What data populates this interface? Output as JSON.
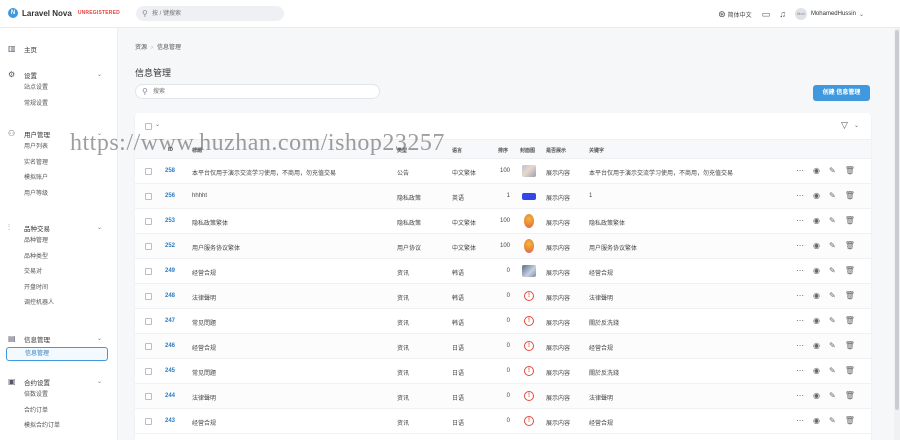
{
  "header": {
    "brand": "Laravel Nova",
    "tag": "UNREGISTERED",
    "search_placeholder": "按 / 键搜索",
    "language": "简体中文",
    "user_name": "MohamedHussin",
    "avatar_alt": "Moh"
  },
  "sidebar": [
    {
      "label": "主页",
      "icon": "dashboard-icon",
      "items": []
    },
    {
      "label": "设置",
      "icon": "gear-icon",
      "items": [
        "站点设置",
        "常规设置"
      ]
    },
    {
      "label": "用户管理",
      "icon": "users-icon",
      "items": [
        "用户列表",
        "实名管理",
        "模拟账户",
        "用户等级"
      ]
    },
    {
      "label": "品种交易",
      "icon": "sliders-icon",
      "items": [
        "品种管理",
        "品种类型",
        "交易对",
        "开盘时间",
        "调控机器人"
      ]
    },
    {
      "label": "信息管理",
      "icon": "message-icon",
      "items": [
        "信息管理"
      ]
    },
    {
      "label": "合约设置",
      "icon": "contract-icon",
      "items": [
        "倍数设置",
        "合约订单",
        "模拟合约订单"
      ]
    }
  ],
  "breadcrumb": {
    "root": "资源",
    "current": "信息管理"
  },
  "page_title": "信息管理",
  "search_placeholder": "搜索",
  "create_label": "创建 信息管理",
  "table": {
    "headers": {
      "id": "ID",
      "title": "标题",
      "type": "类型",
      "lang": "语言",
      "sort": "排序",
      "cover": "封面图",
      "show": "是否展示",
      "keyword": "关键字"
    },
    "rows": [
      {
        "id": "258",
        "title": "本平台仅用于演示交流学习使用，不商用，勿充值交易",
        "type": "公告",
        "lang": "中文繁体",
        "sort": "100",
        "cover": "photo",
        "show": "展示内容",
        "keyword": "本平台仅用于演示交流学习使用，不商用，勿充值交易"
      },
      {
        "id": "256",
        "title": "hhhht",
        "type": "隐私政策",
        "lang": "英语",
        "sort": "1",
        "cover": "blue",
        "show": "展示内容",
        "keyword": "1"
      },
      {
        "id": "253",
        "title": "隐私政策繁体",
        "type": "隐私政策",
        "lang": "中文繁体",
        "sort": "100",
        "cover": "bag",
        "show": "展示内容",
        "keyword": "隐私政策繁体"
      },
      {
        "id": "252",
        "title": "用户服务协议繁体",
        "type": "用户协议",
        "lang": "中文繁体",
        "sort": "100",
        "cover": "bag",
        "show": "展示内容",
        "keyword": "用户服务协议繁体"
      },
      {
        "id": "249",
        "title": "经营合规",
        "type": "资讯",
        "lang": "韩语",
        "sort": "0",
        "cover": "doc",
        "show": "展示内容",
        "keyword": "经营合规"
      },
      {
        "id": "248",
        "title": "法律聲明",
        "type": "资讯",
        "lang": "韩语",
        "sort": "0",
        "cover": "err",
        "show": "展示内容",
        "keyword": "法律聲明"
      },
      {
        "id": "247",
        "title": "常见問題",
        "type": "资讯",
        "lang": "韩语",
        "sort": "0",
        "cover": "err",
        "show": "展示内容",
        "keyword": "關於反洗錢"
      },
      {
        "id": "246",
        "title": "经营合规",
        "type": "资讯",
        "lang": "日语",
        "sort": "0",
        "cover": "err",
        "show": "展示内容",
        "keyword": "经营合规"
      },
      {
        "id": "245",
        "title": "常见問題",
        "type": "资讯",
        "lang": "日语",
        "sort": "0",
        "cover": "err",
        "show": "展示内容",
        "keyword": "關於反洗錢"
      },
      {
        "id": "244",
        "title": "法律聲明",
        "type": "资讯",
        "lang": "日语",
        "sort": "0",
        "cover": "err",
        "show": "展示内容",
        "keyword": "法律聲明"
      },
      {
        "id": "243",
        "title": "经营合规",
        "type": "资讯",
        "lang": "日语",
        "sort": "0",
        "cover": "err",
        "show": "展示内容",
        "keyword": "经营合规"
      }
    ]
  },
  "watermark": "https://www.huzhan.com/ishop23257",
  "colors": {
    "accent": "#4099de",
    "error": "#e24b3b",
    "brand_tag": "#e74444"
  }
}
